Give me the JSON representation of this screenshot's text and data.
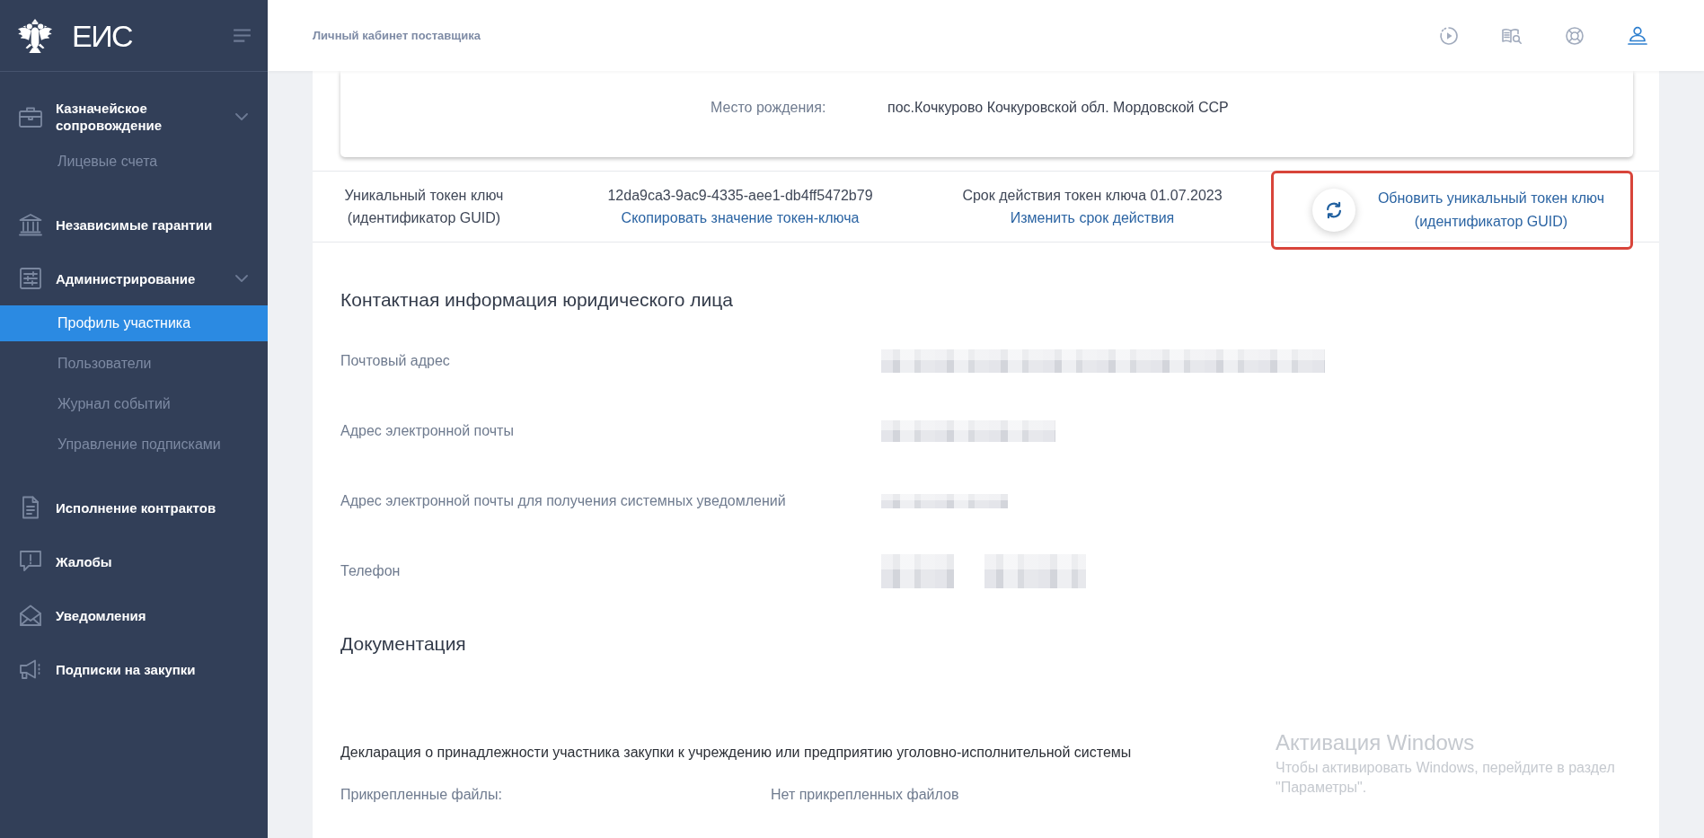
{
  "sidebar": {
    "logo": "ЕИС",
    "items": [
      {
        "kind": "group",
        "label": "Казначейское сопровождение",
        "selected": false,
        "expanded": true,
        "children": [
          {
            "label": "Лицевые счета",
            "selected": false
          }
        ]
      },
      {
        "kind": "link",
        "label": "Независимые гарантии",
        "selected": false
      },
      {
        "kind": "group",
        "label": "Администрирование",
        "selected": false,
        "expanded": true,
        "children": [
          {
            "label": "Профиль участника",
            "selected": true
          },
          {
            "label": "Пользователи",
            "selected": false
          },
          {
            "label": "Журнал событий",
            "selected": false
          },
          {
            "label": "Управление подписками",
            "selected": false
          }
        ]
      },
      {
        "kind": "link",
        "label": "Исполнение контрактов",
        "selected": false
      },
      {
        "kind": "link",
        "label": "Жалобы",
        "selected": false
      },
      {
        "kind": "link",
        "label": "Уведомления",
        "selected": false
      },
      {
        "kind": "link",
        "label": "Подписки на закупки",
        "selected": false
      }
    ]
  },
  "header": {
    "title": "Личный кабинет поставщика"
  },
  "birth_place": {
    "label": "Место рождения:",
    "value": "пос.Кочкурово Кочкуровской обл. Мордовской ССР"
  },
  "token": {
    "label": "Уникальный токен ключ (идентификатор GUID)",
    "value": "12da9ca3-9ac9-4335-aee1-db4ff5472b79",
    "copy_link": "Скопировать значение токен-ключа",
    "expiry": "Срок действия токен ключа 01.07.2023",
    "change_expiry_link": "Изменить срок действия",
    "refresh": {
      "label": "Обновить уникальный токен ключ (идентификатор GUID)",
      "highlighted": true
    }
  },
  "contact": {
    "title": "Контактная информация юридического лица",
    "fields": [
      {
        "label": "Почтовый адрес",
        "redacted": true
      },
      {
        "label": "Адрес электронной почты",
        "redacted": true
      },
      {
        "label": "Адрес электронной почты для получения системных уведомлений",
        "redacted": true
      },
      {
        "label": "Телефон",
        "redacted": true
      }
    ]
  },
  "documentation": {
    "title": "Документация",
    "declaration": "Декларация о принадлежности участника закупки к учреждению или предприятию уголовно-исполнительной системы",
    "attachments": {
      "label": "Прикрепленные файлы:",
      "value": "Нет прикрепленных файлов"
    }
  },
  "os_notice": {
    "title": "Активация Windows",
    "message": "Чтобы активировать Windows, перейдите в раздел \"Параметры\"."
  }
}
